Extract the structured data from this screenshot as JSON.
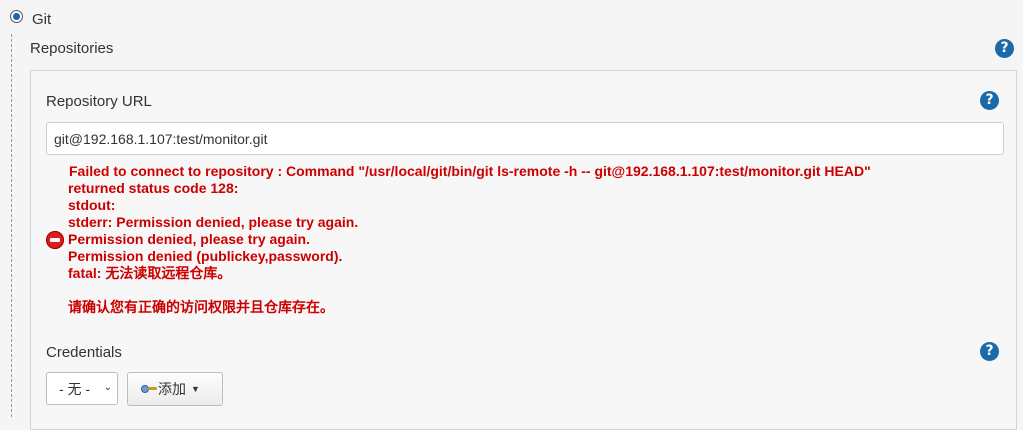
{
  "scm_option": {
    "label": "Git",
    "selected": true
  },
  "repositories": {
    "title": "Repositories"
  },
  "repository_url": {
    "label": "Repository URL",
    "value": "git@192.168.1.107:test/monitor.git"
  },
  "error": {
    "lines": [
      "Failed to connect to repository : Command \"/usr/local/git/bin/git ls-remote -h -- git@192.168.1.107:test/monitor.git HEAD\"",
      "returned status code 128:",
      "stdout:",
      "stderr: Permission denied, please try again.",
      "Permission denied, please try again.",
      "Permission denied (publickey,password).",
      "fatal: 无法读取远程仓库。",
      "",
      "请确认您有正确的访问权限并且仓库存在。"
    ]
  },
  "credentials": {
    "label": "Credentials",
    "selected": "- 无 -",
    "add_label": "添加"
  },
  "help": {
    "symbol": "?"
  },
  "colors": {
    "error": "#cc0000",
    "help": "#1a6aa8",
    "accent": "#1f5fbf"
  },
  "icons": [
    "help-icon",
    "error-icon",
    "key-icon",
    "caret-down-icon"
  ]
}
